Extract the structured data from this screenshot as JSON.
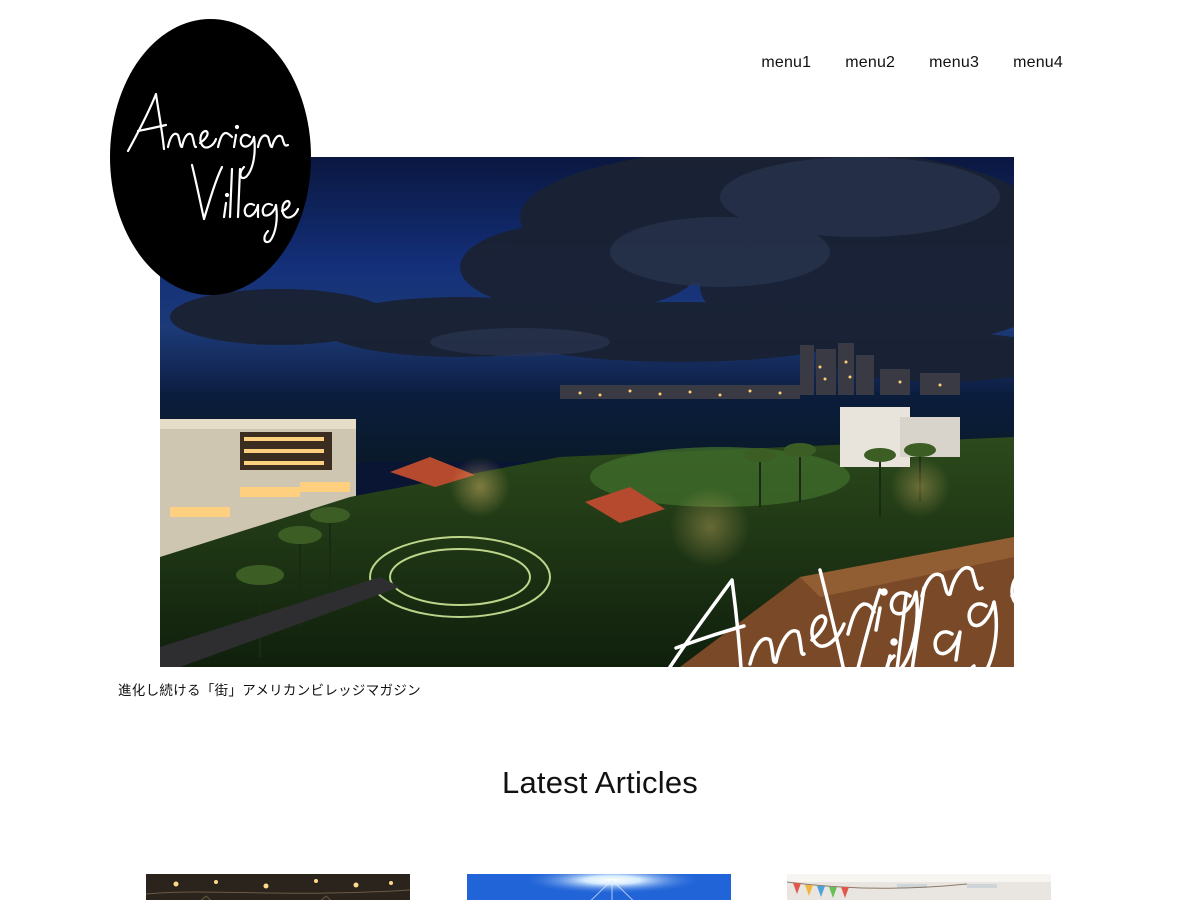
{
  "site": {
    "logo_text": "American Village",
    "tagline": "進化し続ける「街」アメリカンビレッジマガジン"
  },
  "nav": {
    "items": [
      {
        "label": "menu1"
      },
      {
        "label": "menu2"
      },
      {
        "label": "menu3"
      },
      {
        "label": "menu4"
      }
    ]
  },
  "hero": {
    "overlay_script_text": "American Village",
    "image_description_icon": "night-cityscape-image"
  },
  "articles": {
    "section_title": "Latest Articles",
    "cards": [
      {
        "thumbnail_icon": "cafe-interior-thumbnail"
      },
      {
        "thumbnail_icon": "blue-sky-sun-thumbnail"
      },
      {
        "thumbnail_icon": "bunting-flags-thumbnail"
      }
    ]
  },
  "colors": {
    "background": "#ffffff",
    "text": "#111111",
    "logo_bg": "#000000",
    "night_sky": "#0b1a4a"
  }
}
